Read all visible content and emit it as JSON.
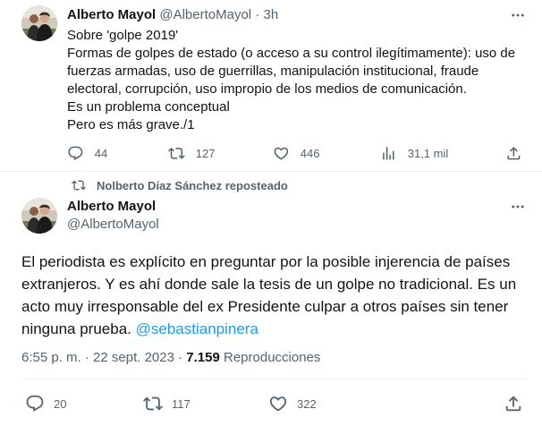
{
  "tweet1": {
    "name": "Alberto Mayol",
    "handle": "@AlbertoMayol",
    "separator": "·",
    "time": "3h",
    "lines": [
      "Sobre 'golpe 2019'",
      "Formas de golpes de estado (o acceso a su control ilegítimamente): uso de",
      "fuerzas armadas, uso de guerrillas, manipulación institucional, fraude",
      "electoral, corrupción, uso impropio de los medios de comunicación.",
      "Es un problema conceptual",
      "Pero es más grave./1"
    ],
    "actions": {
      "replies": "44",
      "reposts": "127",
      "likes": "446",
      "views": "31,1 mil"
    }
  },
  "repost_label": "Nolberto Díaz Sánchez reposteado",
  "tweet2": {
    "name": "Alberto Mayol",
    "handle": "@AlbertoMayol",
    "lines": [
      "El periodista es explícito en preguntar por la posible injerencia de países",
      "extranjeros. Y es ahí donde sale la tesis de un golpe no tradicional. Es un",
      "acto muy irresponsable del ex Presidente culpar a otros países sin tener",
      "ninguna prueba."
    ],
    "mention": "@sebastianpinera",
    "timestamp": "6:55 p. m. · 22 sept. 2023 · ",
    "views_count": "7.159",
    "views_label": " Reproducciones",
    "actions": {
      "replies": "20",
      "reposts": "117",
      "likes": "322"
    }
  },
  "icons": {
    "more": "more-icon",
    "reply": "reply-icon",
    "repost": "repost-icon",
    "like": "heart-icon",
    "views": "analytics-icon",
    "share": "share-icon"
  },
  "colors": {
    "text": "#0f1419",
    "secondary": "#536471",
    "link": "#1d9bf0",
    "border": "#eff3f4"
  }
}
